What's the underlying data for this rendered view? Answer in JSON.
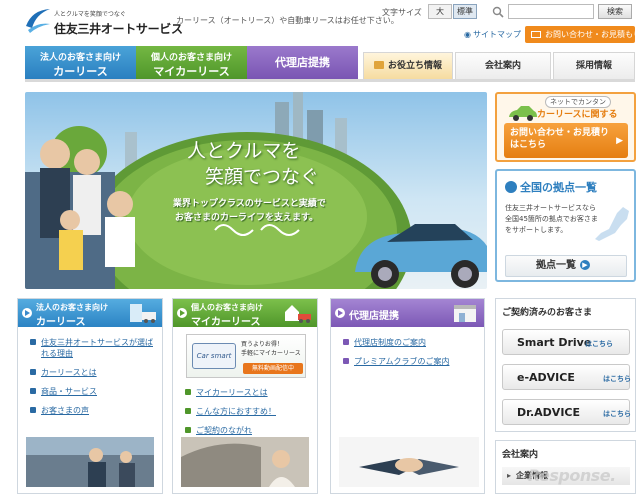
{
  "header": {
    "tagline": "人とクルマを笑顔でつなぐ",
    "company_name": "住友三井オートサービス",
    "description": "カーリース（オートリース）や自動車リースはお任せ下さい。",
    "text_size_label": "文字サイズ",
    "text_size_large": "大",
    "text_size_standard": "標準",
    "search_placeholder": "",
    "search_button": "検索",
    "sitemap": "サイトマップ",
    "contact_button": "お問い合わせ・お見積もり"
  },
  "nav": {
    "corp_line1": "法人のお客さま向け",
    "corp_line2": "カーリース",
    "indiv_line1": "個人のお客さま向け",
    "indiv_line2": "マイカーリース",
    "agent": "代理店提携",
    "useful": "お役立ち情報",
    "company": "会社案内",
    "recruit": "採用情報"
  },
  "hero": {
    "title_line1": "人とクルマを",
    "title_line2": "笑顔でつなぐ",
    "sub_line1": "業界トップクラスのサービスと実績で",
    "sub_line2": "お客さまのカーライフを支えます。"
  },
  "side": {
    "net_tag": "ネットでカンタン",
    "carlease_label": "カーリースに関する",
    "cta_line1": "お問い合わせ・お見積り",
    "cta_line2": "はこちら",
    "base_title": "全国の拠点一覧",
    "base_desc": "住友三井オートサービスなら全国45箇所の拠点でお客さまをサポートします。",
    "base_button": "拠点一覧"
  },
  "boxes": {
    "corp": {
      "line1": "法人のお客さま向け",
      "line2": "カーリース",
      "links": [
        "住友三井オートサービスが選ばれる理由",
        "カーリースとは",
        "商品・サービス",
        "お客さまの声"
      ]
    },
    "indiv": {
      "line1": "個人のお客さま向け",
      "line2": "マイカーリース",
      "promo_logo": "Car smart",
      "promo_text1": "買うよりお得！",
      "promo_text2": "手軽にマイカーリース",
      "promo_button": "無料動画配信中",
      "links": [
        "マイカーリースとは",
        "こんな方におすすめ！",
        "ご契約のながれ"
      ]
    },
    "agent": {
      "title": "代理店提携",
      "links": [
        "代理店制度のご案内",
        "プレミアムクラブのご案内"
      ]
    }
  },
  "contract": {
    "title": "ご契約済みのお客さま",
    "buttons": [
      {
        "name": "Smart Drive",
        "here": "はこちら"
      },
      {
        "name": "e-ADVICE",
        "here": "はこちら"
      },
      {
        "name": "Dr.ADVICE",
        "here": "はこちら"
      }
    ]
  },
  "company": {
    "title": "会社案内",
    "link": "企業情報"
  },
  "watermark": "Response.",
  "colors": {
    "corp_blue": "#2b83c4",
    "indiv_green": "#4f962a",
    "agent_purple": "#7c58b5",
    "accent_orange": "#e57e11"
  }
}
